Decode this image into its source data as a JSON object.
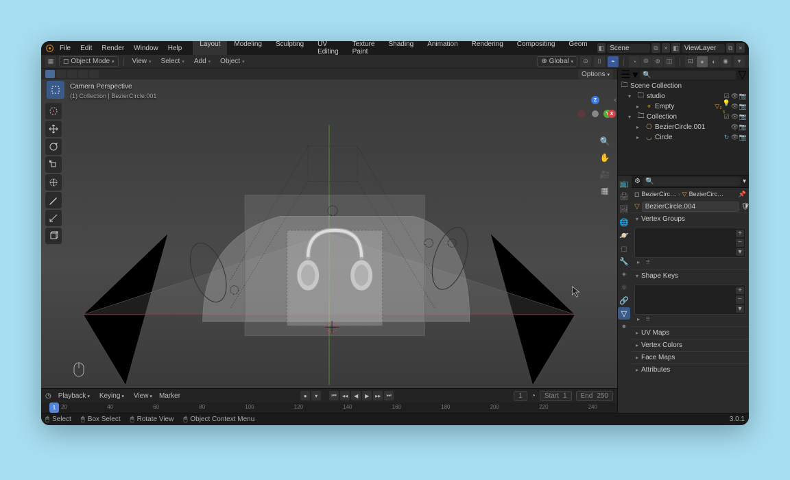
{
  "app": {
    "version": "3.0.1"
  },
  "menus": [
    "File",
    "Edit",
    "Render",
    "Window",
    "Help"
  ],
  "workspace_tabs": [
    "Layout",
    "Modeling",
    "Sculpting",
    "UV Editing",
    "Texture Paint",
    "Shading",
    "Animation",
    "Rendering",
    "Compositing",
    "Geom"
  ],
  "active_workspace": "Layout",
  "scene_name": "Scene",
  "viewlayer_name": "ViewLayer",
  "mode": "Object Mode",
  "view_menus": [
    "View",
    "Select",
    "Add",
    "Object"
  ],
  "orientation": "Global",
  "viewport": {
    "camera_label": "Camera Perspective",
    "collection_path": "(1) Collection | BezierCircle.001",
    "options_label": "Options"
  },
  "gizmo_axes": {
    "x": "X",
    "y": "Y",
    "z": "Z"
  },
  "outliner": {
    "root": "Scene Collection",
    "items": [
      {
        "label": "studio",
        "icon": "collection",
        "depth": 1,
        "expand": "▾",
        "badges": "checkbox"
      },
      {
        "label": "Empty",
        "icon": "empty",
        "depth": 2,
        "expand": "▸",
        "badges": "warn"
      },
      {
        "label": "Collection",
        "icon": "collection",
        "depth": 1,
        "expand": "▾",
        "badges": "checkbox"
      },
      {
        "label": "BezierCircle.001",
        "icon": "curve",
        "depth": 2,
        "expand": "▸",
        "badges": ""
      },
      {
        "label": "Circle",
        "icon": "curve",
        "depth": 2,
        "expand": "▸",
        "badges": "cycle"
      }
    ]
  },
  "props": {
    "breadcrumb1": "BezierCirc…",
    "breadcrumb2": "BezierCirc…",
    "name_field": "BezierCircle.004",
    "sections": [
      "Vertex Groups",
      "Shape Keys",
      "UV Maps",
      "Vertex Colors",
      "Face Maps",
      "Attributes"
    ]
  },
  "timeline": {
    "menus": [
      "Playback",
      "Keying",
      "View",
      "Marker"
    ],
    "current": "1",
    "start_label": "Start",
    "start_value": "1",
    "end_label": "End",
    "end_value": "250",
    "ticks": [
      "20",
      "40",
      "60",
      "80",
      "100",
      "120",
      "140",
      "160",
      "180",
      "200",
      "220",
      "240"
    ],
    "frame_label": "1"
  },
  "statusbar": {
    "select": "Select",
    "box_select": "Box Select",
    "rotate_view": "Rotate View",
    "context_menu": "Object Context Menu"
  },
  "colors": {
    "axis_x": "#d14747",
    "axis_y": "#5faa3a",
    "axis_z": "#3d7adb",
    "accent_blue": "#4a6a9a",
    "curve_orange": "#d99b3b"
  }
}
